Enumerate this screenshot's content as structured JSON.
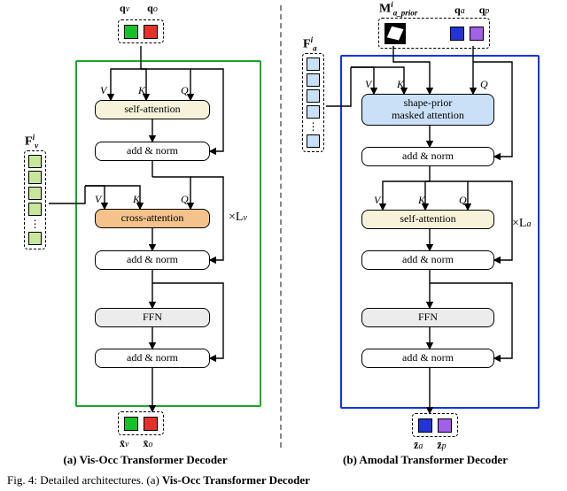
{
  "figure_id": "Fig. 4",
  "figure_text_prefix": "Detailed architectures. (a)",
  "figure_text_suffix": " Vis-Occ Transformer Decoder",
  "left": {
    "caption": "(a) Vis-Occ Transformer Decoder",
    "q_v": "q",
    "q_v_sub": "v",
    "q_o": "q",
    "q_o_sub": "o",
    "feat_label": "F",
    "feat_sub": "v",
    "feat_sup": "i",
    "blocks": {
      "self": "self-attention",
      "add1": "add & norm",
      "cross": "cross-attention",
      "add2": "add & norm",
      "ffn": "FFN",
      "add3": "add & norm"
    },
    "vkq": {
      "V": "V",
      "K": "K",
      "Q": "Q"
    },
    "loop": "×L",
    "loop_sub": "v",
    "out_v": "x̄",
    "out_v_sub": "v",
    "out_o": "x̄",
    "out_o_sub": "o"
  },
  "right": {
    "caption": "(b) Amodal Transformer Decoder",
    "mask_label": "M",
    "mask_sub": "a_prior",
    "mask_sup": "i",
    "q_a": "q",
    "q_a_sub": "a",
    "q_p": "q",
    "q_p_sub": "p",
    "feat_label": "F",
    "feat_sub": "a",
    "feat_sup": "i",
    "blocks": {
      "shape_l1": "shape-prior",
      "shape_l2": "masked attention",
      "add1": "add & norm",
      "self": "self-attention",
      "add2": "add & norm",
      "ffn": "FFN",
      "add3": "add & norm"
    },
    "vkq": {
      "V": "V",
      "K": "K",
      "Q": "Q"
    },
    "loop": "×L",
    "loop_sub": "a",
    "out_a": "z̄",
    "out_a_sub": "a",
    "out_p": "z̄",
    "out_p_sub": "p"
  }
}
